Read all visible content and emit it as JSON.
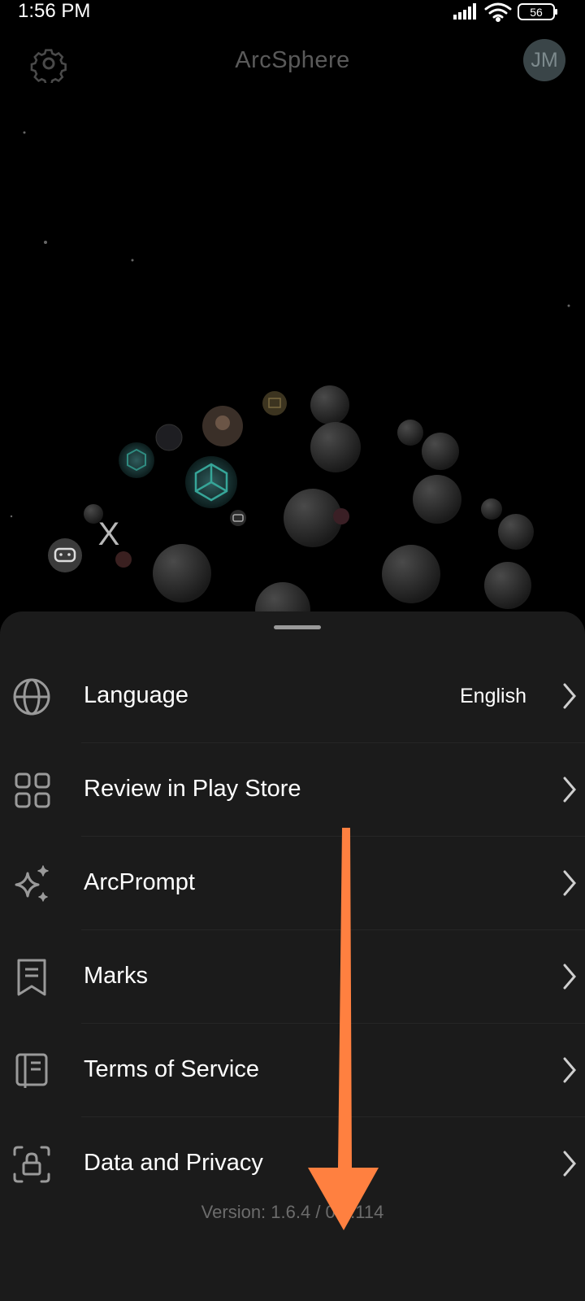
{
  "status_bar": {
    "time": "1:56 PM",
    "battery": "56",
    "icons": [
      "signal-icon",
      "wifi-icon",
      "battery-icon"
    ]
  },
  "header": {
    "title": "ArcSphere",
    "avatar_initials": "JM",
    "settings_icon": "gear-icon"
  },
  "galaxy": {
    "bubble_labels": [
      "X"
    ]
  },
  "menu": {
    "items": [
      {
        "label": "Language",
        "value": "English",
        "icon": "globe-icon"
      },
      {
        "label": "Review in Play Store",
        "icon": "apps-grid-icon"
      },
      {
        "label": "ArcPrompt",
        "icon": "sparkles-icon"
      },
      {
        "label": "Marks",
        "icon": "bookmark-icon"
      },
      {
        "label": "Terms of Service",
        "icon": "document-icon"
      },
      {
        "label": "Data and Privacy",
        "icon": "lock-icon"
      }
    ]
  },
  "version": "Version: 1.6.4 / 0.1.114",
  "colors": {
    "background": "#000000",
    "sheet": "#1b1b1b",
    "annotation_arrow": "#ff8040"
  }
}
